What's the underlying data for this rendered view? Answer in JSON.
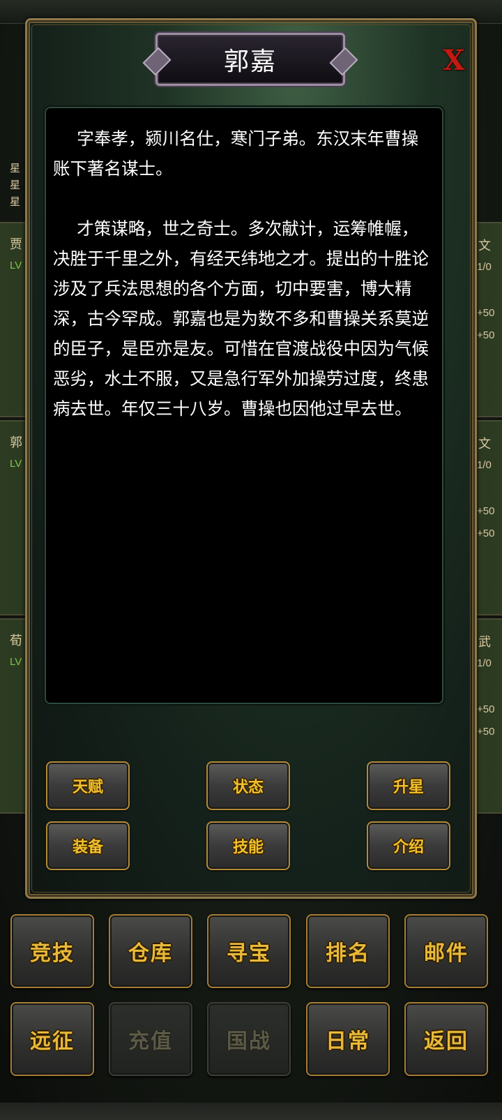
{
  "dialog": {
    "title": "郭嘉",
    "close_label": "X",
    "description": [
      "字奉孝，颍川名仕，寒门子弟。东汉末年曹操账下著名谋士。",
      "才策谋略，世之奇士。多次献计，运筹帷幄，决胜于千里之外，有经天纬地之才。提出的十胜论涉及了兵法思想的各个方面，切中要害，博大精深，古今罕成。郭嘉也是为数不多和曹操关系莫逆的臣子，是臣亦是友。可惜在官渡战役中因为气候恶劣，水土不服，又是急行军外加操劳过度，终患病去世。年仅三十八岁。曹操也因他过早去世。"
    ],
    "buttons": {
      "talent": "天赋",
      "status": "状态",
      "star_up": "升星",
      "equipment": "装备",
      "skill": "技能",
      "intro": "介绍"
    }
  },
  "background_rows": [
    {
      "name_char": "贾",
      "right_label": "文",
      "level": "1/0",
      "bonus_1": "+50",
      "bonus_2": "+50"
    },
    {
      "name_char": "郭",
      "right_label": "文",
      "level": "1/0",
      "bonus_1": "+50",
      "bonus_2": "+50"
    },
    {
      "name_char": "荀",
      "right_label": "武",
      "level": "1/0",
      "bonus_1": "+50",
      "bonus_2": "+50"
    }
  ],
  "background_left_labels": {
    "star": "星",
    "lv": "LV"
  },
  "menu": {
    "row1": [
      "竞技",
      "仓库",
      "寻宝",
      "排名",
      "邮件"
    ],
    "row2": [
      "远征",
      "充值",
      "国战",
      "日常",
      "返回"
    ]
  },
  "colors": {
    "button_text": "#f2c12c",
    "button_border": "#b38a35",
    "close_x": "#c21a12",
    "panel_bg": "#000000"
  }
}
